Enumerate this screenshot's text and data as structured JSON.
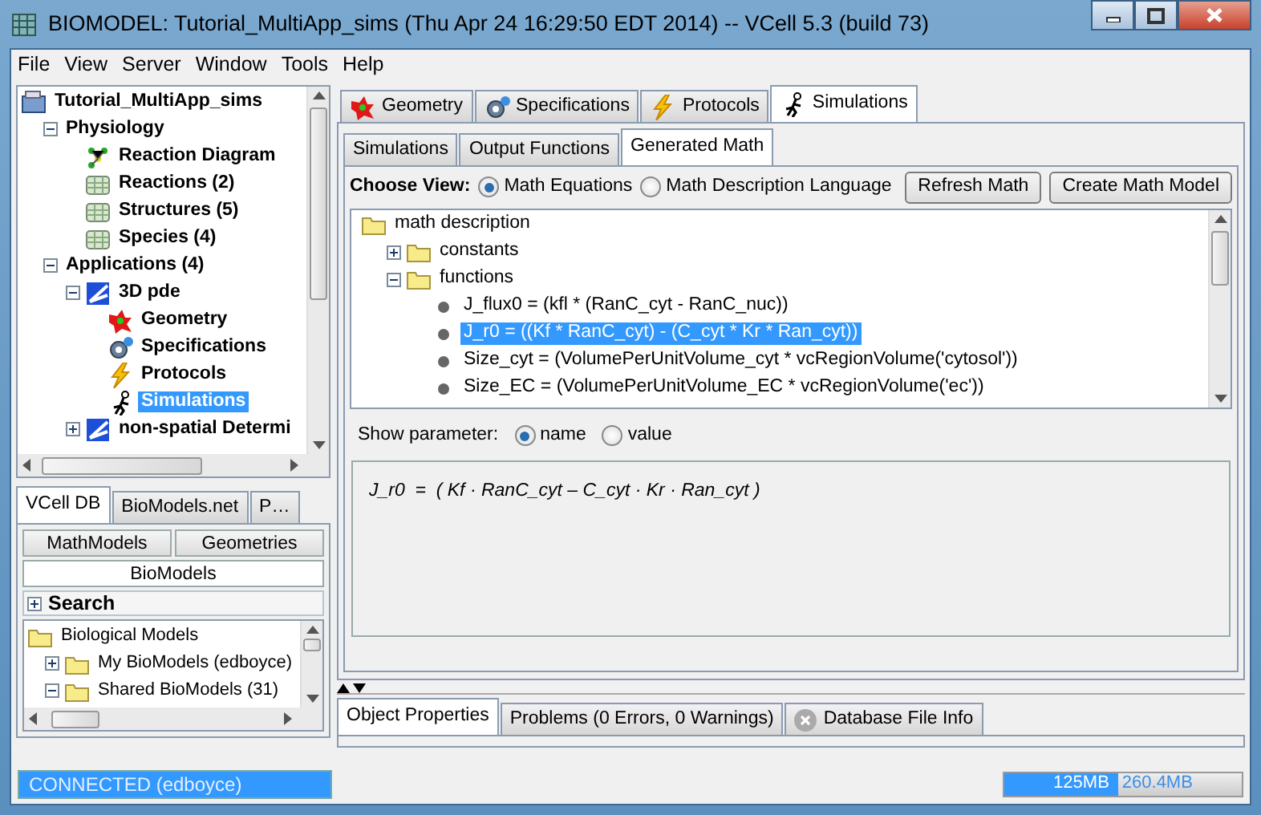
{
  "window": {
    "title": "BIOMODEL: Tutorial_MultiApp_sims (Thu Apr 24 16:29:50 EDT 2014) -- VCell 5.3 (build 73)"
  },
  "menu": [
    "File",
    "View",
    "Server",
    "Window",
    "Tools",
    "Help"
  ],
  "model_tree": [
    {
      "label": "Tutorial_MultiApp_sims",
      "kind": "model",
      "selected": false,
      "children": [
        {
          "label": "Physiology",
          "expanded": true,
          "selected": false,
          "children": [
            {
              "label": "Reaction Diagram",
              "kind": "diagram",
              "selected": false
            },
            {
              "label": "Reactions (2)",
              "kind": "table",
              "selected": false
            },
            {
              "label": "Structures (5)",
              "kind": "table",
              "selected": false
            },
            {
              "label": "Species (4)",
              "kind": "table",
              "selected": false
            }
          ]
        },
        {
          "label": "Applications (4)",
          "expanded": true,
          "selected": false,
          "children": [
            {
              "label": "3D pde",
              "kind": "app",
              "expanded": true,
              "selected": false,
              "children": [
                {
                  "label": "Geometry",
                  "kind": "geometry",
                  "selected": false
                },
                {
                  "label": "Specifications",
                  "kind": "gear",
                  "selected": false
                },
                {
                  "label": "Protocols",
                  "kind": "bolt",
                  "selected": false
                },
                {
                  "label": "Simulations",
                  "kind": "runner",
                  "selected": true
                }
              ]
            },
            {
              "label": "non-spatial Determi",
              "kind": "app",
              "expanded": false,
              "selected": false
            }
          ]
        }
      ]
    }
  ],
  "db_tabs": [
    {
      "label": "VCell DB",
      "selected": true
    },
    {
      "label": "BioModels.net",
      "selected": false
    },
    {
      "label": "P…",
      "selected": false
    }
  ],
  "db_categories": [
    {
      "label": "MathModels",
      "selected": false
    },
    {
      "label": "Geometries",
      "selected": false
    },
    {
      "label": "BioModels",
      "selected": true
    }
  ],
  "search": {
    "label": "Search",
    "expanded": false
  },
  "db_tree": [
    {
      "label": "Biological Models",
      "kind": "folder",
      "selected": false,
      "children": [
        {
          "label": "My BioModels (edboyce)",
          "kind": "folder",
          "expanded": false,
          "selected": false
        },
        {
          "label": "Shared BioModels (31)",
          "kind": "folder",
          "expanded": true,
          "selected": false
        }
      ]
    }
  ],
  "connection_status": "CONNECTED (edboyce)",
  "app_tabs": [
    {
      "label": "Geometry",
      "kind": "geometry",
      "selected": false
    },
    {
      "label": "Specifications",
      "kind": "gear",
      "selected": false
    },
    {
      "label": "Protocols",
      "kind": "bolt",
      "selected": false
    },
    {
      "label": "Simulations",
      "kind": "runner",
      "selected": true
    }
  ],
  "sim_tabs": [
    {
      "label": "Simulations",
      "selected": false
    },
    {
      "label": "Output Functions",
      "selected": false
    },
    {
      "label": "Generated Math",
      "selected": true
    }
  ],
  "choose_view": {
    "label": "Choose View:",
    "options": [
      {
        "label": "Math Equations",
        "selected": true
      },
      {
        "label": "Math Description Language",
        "selected": false
      }
    ]
  },
  "buttons": [
    "Refresh Math",
    "Create Math Model"
  ],
  "math_tree": [
    {
      "label": "math description",
      "kind": "folder",
      "selected": false,
      "children": [
        {
          "label": "constants",
          "kind": "folder",
          "expanded": false,
          "selected": false
        },
        {
          "label": "functions",
          "kind": "folder",
          "expanded": true,
          "selected": false,
          "children": [
            {
              "label": "J_flux0 = (kfl * (RanC_cyt - RanC_nuc))",
              "kind": "dot",
              "selected": false
            },
            {
              "label": "J_r0 = ((Kf * RanC_cyt) - (C_cyt * Kr * Ran_cyt))",
              "kind": "dot",
              "selected": true
            },
            {
              "label": "Size_cyt = (VolumePerUnitVolume_cyt * vcRegionVolume('cytosol'))",
              "kind": "dot",
              "selected": false
            },
            {
              "label": "Size_EC = (VolumePerUnitVolume_EC * vcRegionVolume('ec'))",
              "kind": "dot",
              "selected": false
            }
          ]
        }
      ]
    }
  ],
  "show_parameter": {
    "label": "Show parameter:",
    "options": [
      {
        "label": "name",
        "selected": true
      },
      {
        "label": "value",
        "selected": false
      }
    ]
  },
  "equation": "J_r0  =  ( Kf · RanC_cyt – C_cyt · Kr · Ran_cyt )",
  "bottom_tabs": [
    {
      "label": "Object Properties",
      "kind": "plain",
      "selected": true
    },
    {
      "label": "Problems (0 Errors, 0 Warnings)",
      "kind": "plain",
      "selected": false
    },
    {
      "label": "Database File Info",
      "kind": "closable",
      "selected": false
    }
  ],
  "memory": {
    "used": "125MB",
    "total": "260.4MB",
    "level": 0.48
  }
}
